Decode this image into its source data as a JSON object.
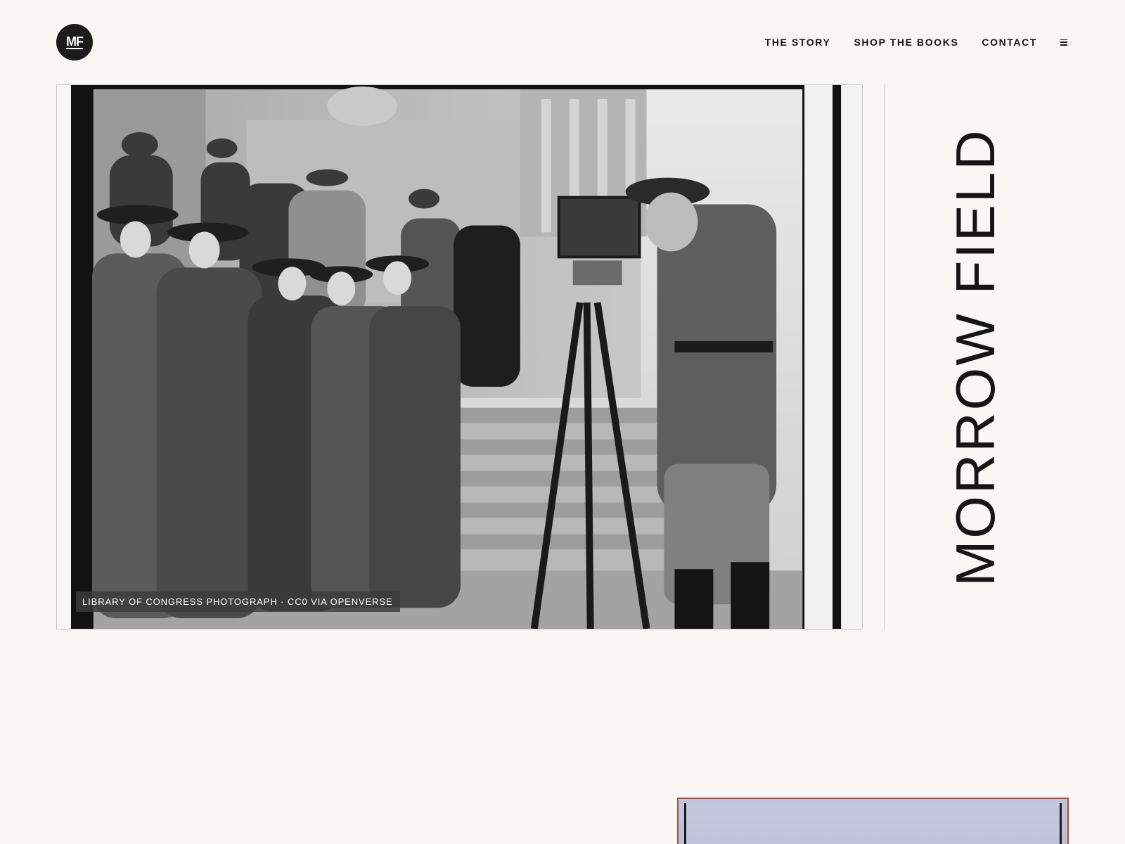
{
  "header": {
    "logo_text": "MF",
    "nav": [
      {
        "label": "THE STORY"
      },
      {
        "label": "SHOP THE BOOKS"
      },
      {
        "label": "CONTACT"
      }
    ],
    "menu_icon": "hamburger-menu-icon"
  },
  "hero": {
    "image_description_icon": "historical-photo",
    "caption": "LIBRARY OF CONGRESS PHOTOGRAPH · CC0 VIA OPENVERSE"
  },
  "sidebar": {
    "vertical_title": "MORROW FIELD"
  },
  "colors": {
    "background": "#f8f7f4",
    "text": "#161616",
    "logo_bg": "#1b1b1b",
    "teaser_border": "#b9473f",
    "teaser_fill": "#c3c4dc"
  }
}
